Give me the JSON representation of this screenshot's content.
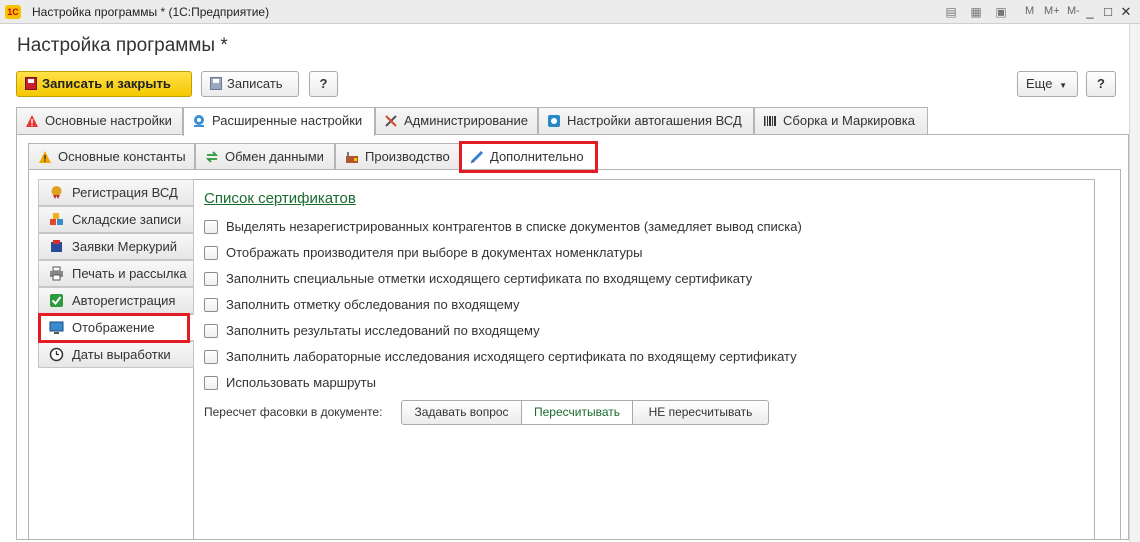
{
  "window": {
    "title": "Настройка программы * (1С:Предприятие)",
    "logo_text": "1С",
    "controls": {
      "mem": "M",
      "mem_plus": "M+",
      "mem_minus": "M-",
      "minimize": "_",
      "maximize": "□",
      "close": "✕"
    }
  },
  "page": {
    "title": "Настройка программы *"
  },
  "toolbar": {
    "save_close": "Записать и закрыть",
    "save": "Записать",
    "help": "?",
    "more": "Еще",
    "help_right": "?"
  },
  "tabs_main": [
    {
      "label": "Основные настройки",
      "icon": "warning-icon"
    },
    {
      "label": "Расширенные настройки",
      "icon": "extended-settings-icon"
    },
    {
      "label": "Администрирование",
      "icon": "tools-icon"
    },
    {
      "label": "Настройки автогашения ВСД",
      "icon": "auto-cancel-icon"
    },
    {
      "label": "Сборка и Маркировка",
      "icon": "barcode-icon"
    }
  ],
  "tabs_sub": [
    {
      "label": "Основные константы",
      "icon": "warning-icon"
    },
    {
      "label": "Обмен данными",
      "icon": "exchange-icon"
    },
    {
      "label": "Производство",
      "icon": "factory-icon"
    },
    {
      "label": "Дополнительно",
      "icon": "syringe-icon"
    }
  ],
  "sidebar": [
    {
      "label": "Регистрация ВСД",
      "icon": "certificate-icon"
    },
    {
      "label": "Складские записи",
      "icon": "warehouse-icon"
    },
    {
      "label": "Заявки Меркурий",
      "icon": "requests-icon"
    },
    {
      "label": "Печать и рассылка",
      "icon": "printer-icon"
    },
    {
      "label": "Авторегистрация",
      "icon": "check-icon"
    },
    {
      "label": "Отображение",
      "icon": "monitor-icon"
    },
    {
      "label": "Даты выработки",
      "icon": "clock-icon"
    }
  ],
  "content": {
    "section_link": "Список сертификатов",
    "checkboxes": [
      {
        "label": "Выделять незарегистрированных контрагентов в списке документов (замедляет вывод списка)",
        "checked": false
      },
      {
        "label": "Отображать производителя при выборе в документах номенклатуры",
        "checked": false
      },
      {
        "label": "Заполнить специальные отметки исходящего сертификата по входящему сертификату",
        "checked": false
      },
      {
        "label": "Заполнить отметку обследования по входящему",
        "checked": false
      },
      {
        "label": "Заполнить результаты исследований по входящему",
        "checked": false
      },
      {
        "label": "Заполнить лабораторные исследования исходящего сертификата по входящему сертификату",
        "checked": false
      },
      {
        "label": "Использовать маршруты",
        "checked": false
      }
    ],
    "recalc": {
      "label": "Пересчет фасовки в документе:",
      "options": [
        "Задавать вопрос",
        "Пересчитывать",
        "НЕ пересчитывать"
      ],
      "selected": "Пересчитывать"
    }
  },
  "colors": {
    "accent_yellow": "#f5c800",
    "highlight_red": "#e31b23",
    "link_green": "#1a6b2e"
  }
}
